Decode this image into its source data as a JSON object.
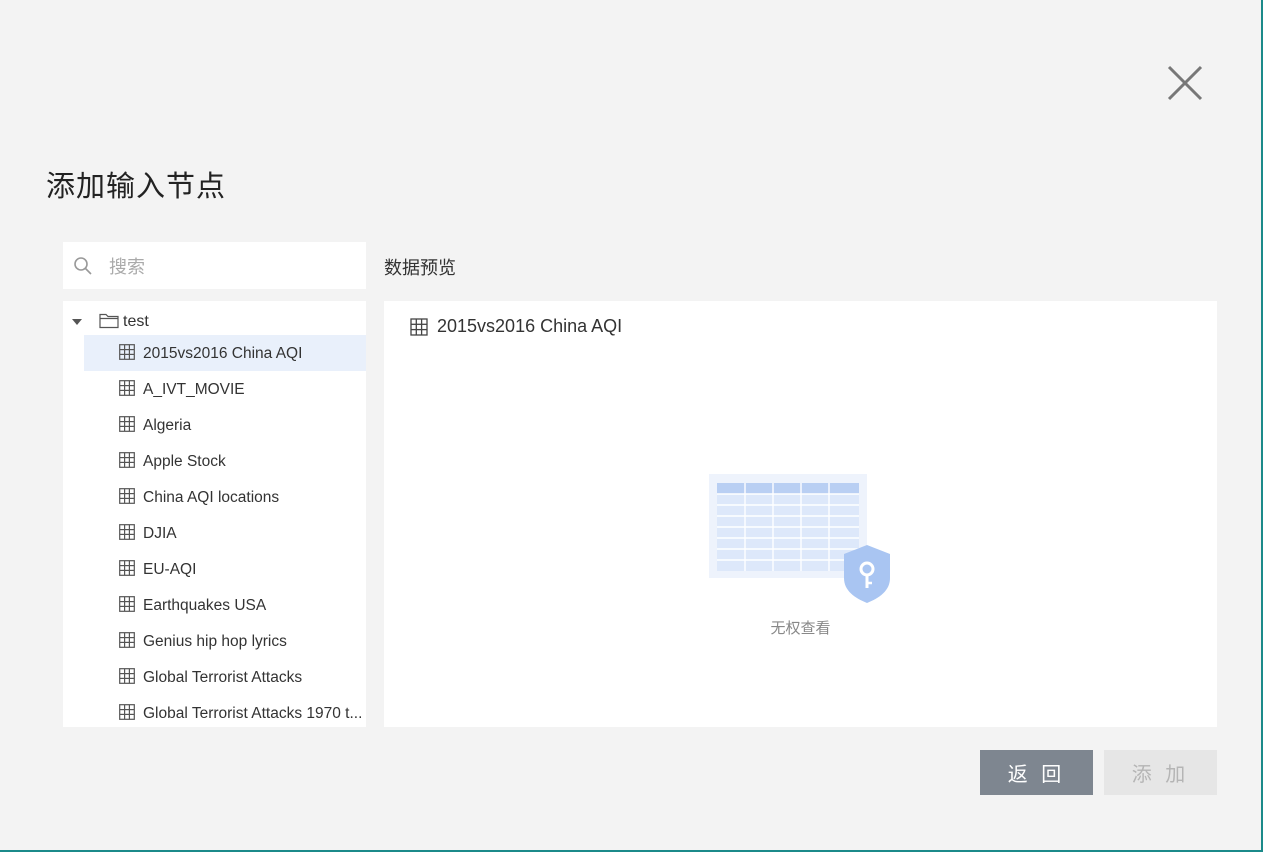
{
  "dialog": {
    "title": "添加输入节点"
  },
  "search": {
    "placeholder": "搜索",
    "value": ""
  },
  "tree": {
    "folder": "test",
    "items": [
      {
        "label": "2015vs2016 China AQI",
        "selected": true
      },
      {
        "label": "A_IVT_MOVIE"
      },
      {
        "label": "Algeria"
      },
      {
        "label": "Apple Stock"
      },
      {
        "label": "China AQI locations"
      },
      {
        "label": "DJIA"
      },
      {
        "label": "EU-AQI"
      },
      {
        "label": "Earthquakes USA"
      },
      {
        "label": "Genius hip hop lyrics"
      },
      {
        "label": "Global Terrorist Attacks"
      },
      {
        "label": "Global Terrorist Attacks 1970 t..."
      }
    ]
  },
  "preview": {
    "title": "数据预览",
    "selected_label": "2015vs2016 China AQI",
    "empty_text": "无权查看"
  },
  "buttons": {
    "back": "返 回",
    "add": "添 加"
  },
  "colors": {
    "background": "#f3f3f3",
    "selected_row": "#e9f0fb",
    "back_button": "#7e8690",
    "add_button_disabled": "#e6e6e6",
    "illustration_blue": "#a9c5f2"
  }
}
